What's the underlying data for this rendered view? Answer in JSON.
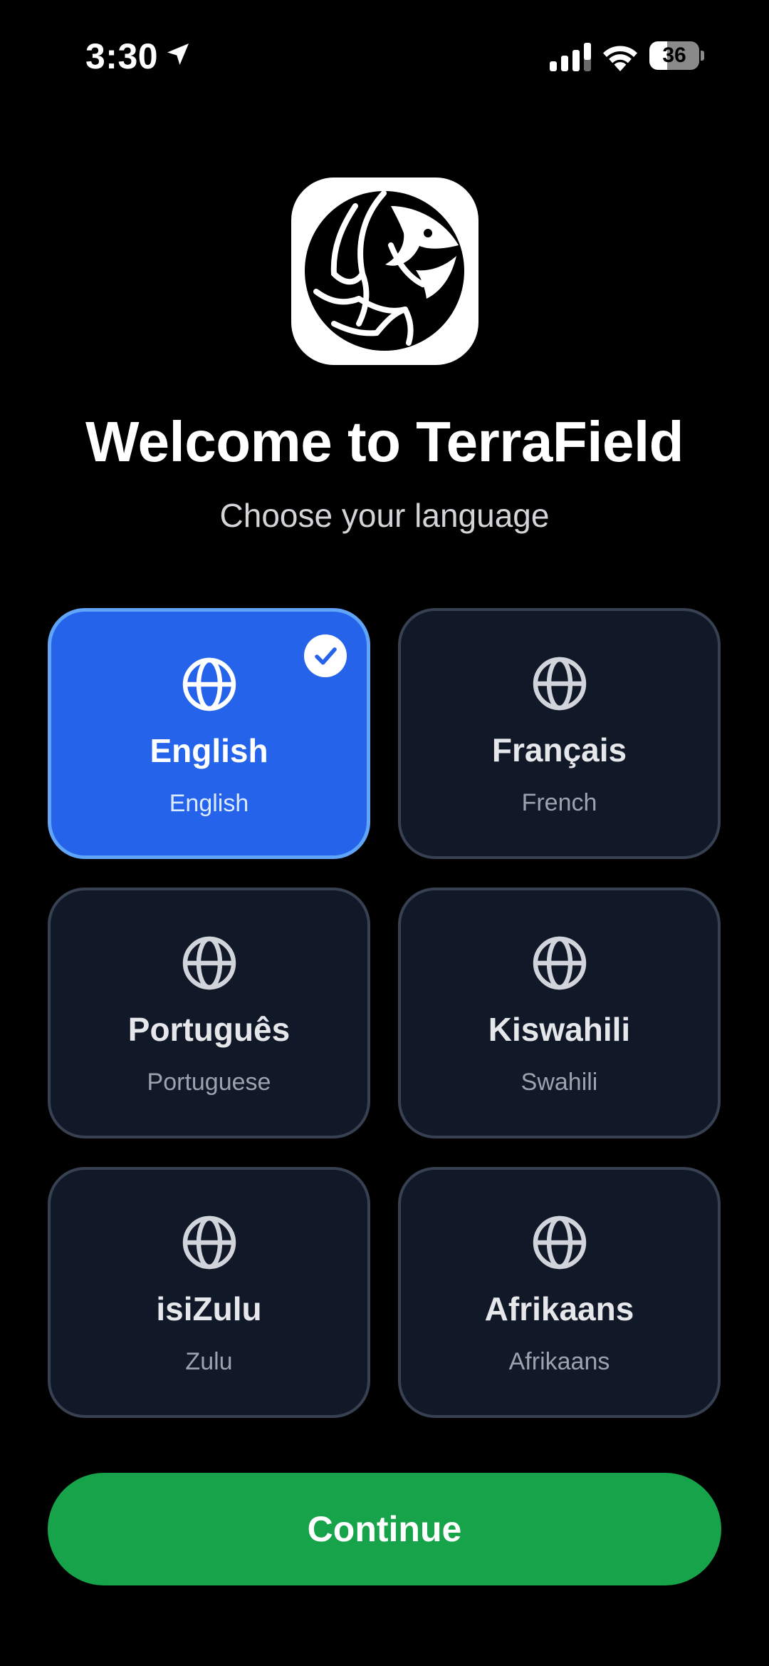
{
  "status_bar": {
    "time": "3:30",
    "battery_level": "36",
    "icons": [
      "location-arrow-icon",
      "cellular-signal-icon",
      "wifi-icon",
      "battery-icon"
    ]
  },
  "header": {
    "logo_icon": "pangolin-logo",
    "title": "Welcome to TerraField",
    "subtitle": "Choose your language"
  },
  "languages": [
    {
      "native": "English",
      "english": "English",
      "selected": true,
      "icon": "globe-icon"
    },
    {
      "native": "Français",
      "english": "French",
      "selected": false,
      "icon": "globe-icon"
    },
    {
      "native": "Português",
      "english": "Portuguese",
      "selected": false,
      "icon": "globe-icon"
    },
    {
      "native": "Kiswahili",
      "english": "Swahili",
      "selected": false,
      "icon": "globe-icon"
    },
    {
      "native": "isiZulu",
      "english": "Zulu",
      "selected": false,
      "icon": "globe-icon"
    },
    {
      "native": "Afrikaans",
      "english": "Afrikaans",
      "selected": false,
      "icon": "globe-icon"
    }
  ],
  "continue_button": {
    "label": "Continue"
  },
  "colors": {
    "background": "#000000",
    "card": "#111827",
    "card_border": "#374151",
    "selected_card": "#2563eb",
    "selected_border": "#60a5fa",
    "continue": "#16a34a"
  }
}
